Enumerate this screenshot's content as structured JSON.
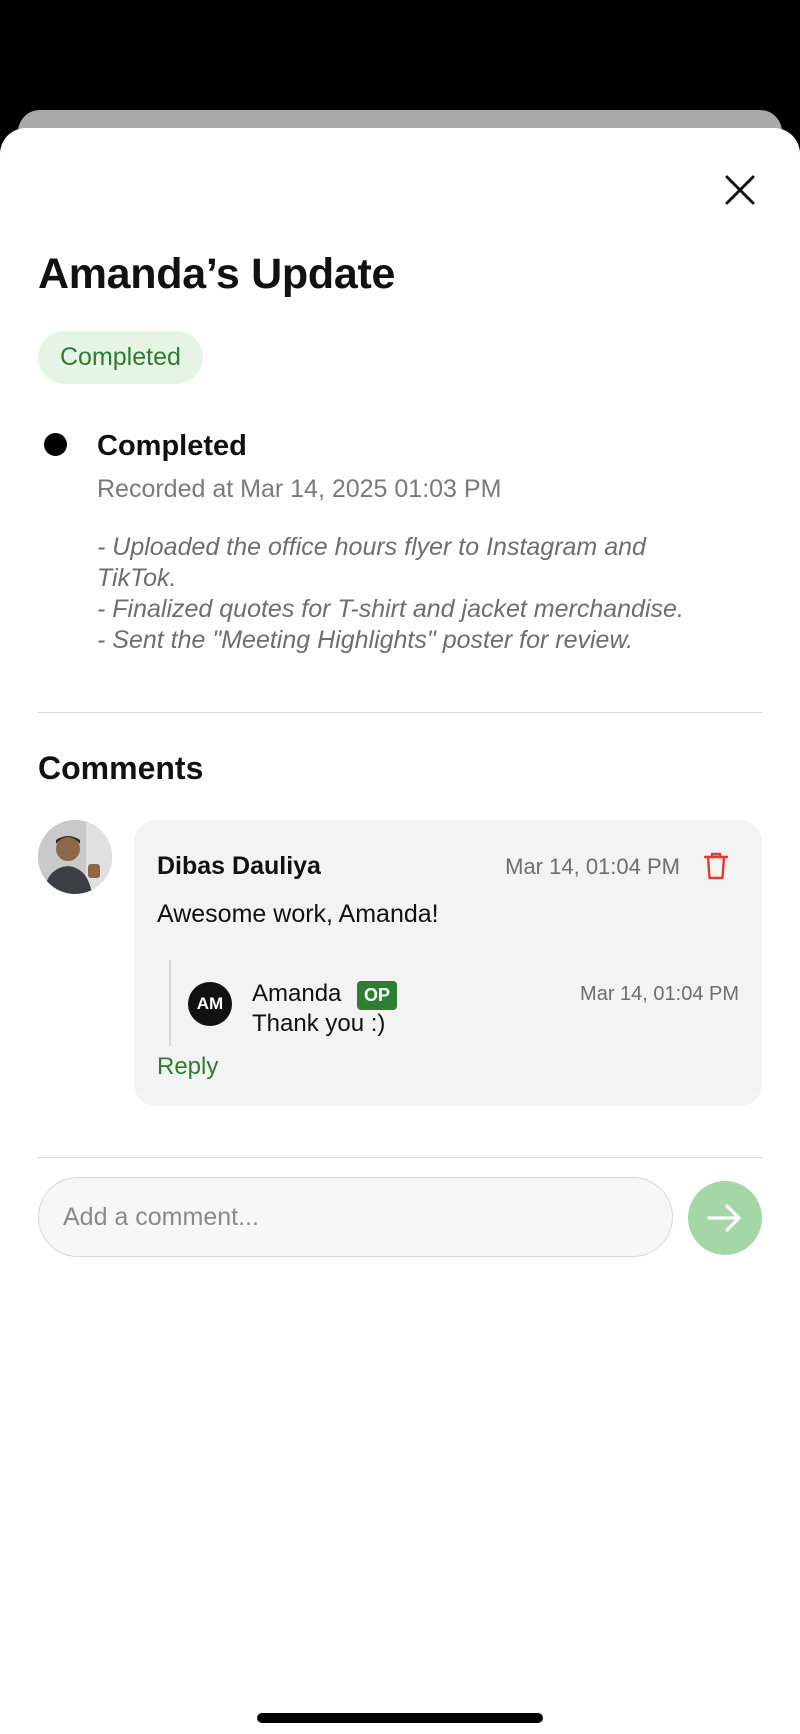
{
  "update": {
    "title": "Amanda’s Update",
    "status": "Completed"
  },
  "entry": {
    "status": "Completed",
    "recorded": "Recorded at Mar 14, 2025 01:03 PM",
    "notes": [
      "- Uploaded the office hours flyer to Instagram and",
      "TikTok.",
      "- Finalized quotes for T-shirt and jacket merchandise.",
      "- Sent the \"Meeting Highlights\" poster for review."
    ]
  },
  "comments": {
    "heading": "Comments",
    "items": [
      {
        "author": "Dibas Dauliya",
        "time": "Mar 14, 01:04 PM",
        "text": "Awesome work, Amanda!",
        "replies": [
          {
            "initials": "AM",
            "author": "Amanda",
            "badge": "OP",
            "time": "Mar 14, 01:04 PM",
            "text": "Thank you :)"
          }
        ],
        "reply_label": "Reply"
      }
    ]
  },
  "composer": {
    "placeholder": "Add a comment..."
  },
  "colors": {
    "accent_green": "#2e7d32",
    "pill_bg": "#e6f4e6",
    "send_button": "#a5d6a7",
    "delete_red": "#e53935"
  },
  "icons": {
    "close": "close-icon",
    "delete": "trash-icon",
    "send": "arrow-right-icon"
  }
}
